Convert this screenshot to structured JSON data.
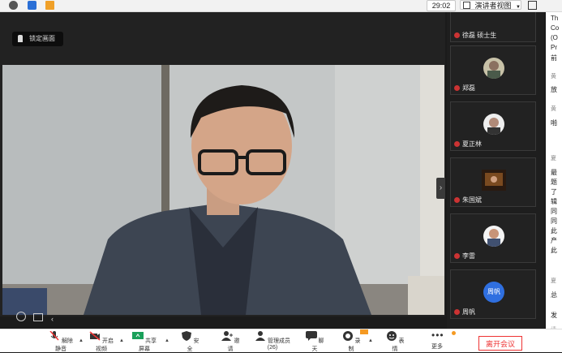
{
  "topbar": {
    "timer": "29:02",
    "view_label": "演讲者视图"
  },
  "stage": {
    "lock_label": "锁定画面",
    "collapse_glyph": "‹",
    "expand_glyph": "›"
  },
  "participants": [
    {
      "name": "徐磊 硕士生"
    },
    {
      "name": "郑磊"
    },
    {
      "name": "夏正林"
    },
    {
      "name": "朱国斌"
    },
    {
      "name": "李雷"
    },
    {
      "name": "周帆",
      "avatar_text": "周帆",
      "avatar_color": "#2f6fe0"
    }
  ],
  "chat": {
    "lines": [
      "Th",
      "Co",
      "(O",
      "Pr",
      "前",
      "黄",
      "放",
      "黄",
      "啪",
      "夏",
      "最",
      "题",
      "了",
      "辑",
      "同",
      "同",
      "此",
      "产",
      "此",
      "夏",
      "总",
      "发",
      "请"
    ]
  },
  "toolbar": {
    "mute": "解除静音",
    "video": "开启视频",
    "share": "共享屏幕",
    "security": "安全",
    "invite": "邀请",
    "members": "管理成员(26)",
    "chat": "聊天",
    "record": "录制",
    "emoji": "表情",
    "more": "更多",
    "leave": "离开会议"
  },
  "colors": {
    "accent": "#2f6fe0",
    "danger": "#e33333",
    "record_badge": "#f59a23"
  }
}
